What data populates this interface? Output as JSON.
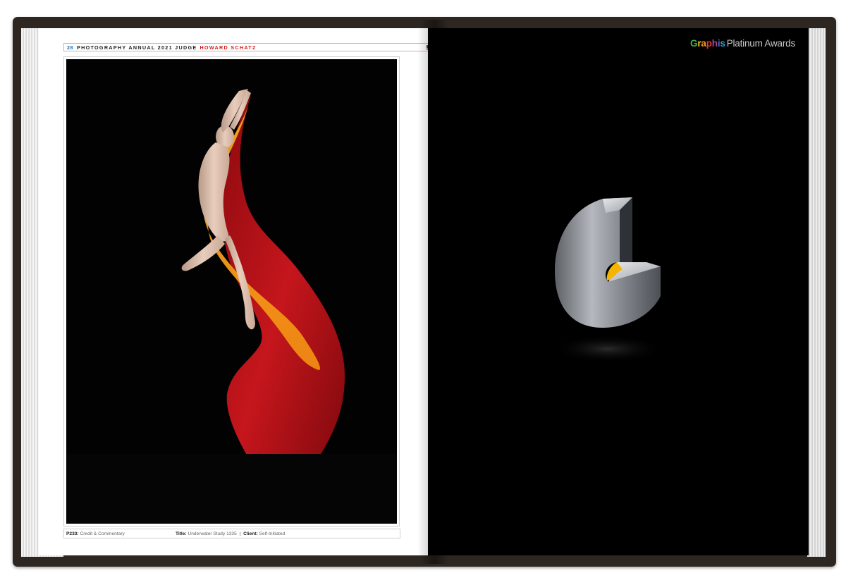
{
  "header": {
    "page_number": "28",
    "title": "PHOTOGRAPHY ANNUAL 2021 JUDGE",
    "judge_name": "HOWARD SCHATZ",
    "flag_icon": "us-flag-icon"
  },
  "footer": {
    "credit_label": "P233:",
    "credit_value": "Credit & Commentary",
    "title_label": "Title:",
    "title_value": "Underwater Study 1335",
    "separator": "|",
    "client_label": "Client:",
    "client_value": "Self-Initiated"
  },
  "logo": {
    "letters": [
      {
        "char": "G",
        "color": "#3db24b"
      },
      {
        "char": "r",
        "color": "#f2c417"
      },
      {
        "char": "a",
        "color": "#f39a1e"
      },
      {
        "char": "p",
        "color": "#e5362f"
      },
      {
        "char": "h",
        "color": "#a6449a"
      },
      {
        "char": "i",
        "color": "#4c6fc0"
      },
      {
        "char": "s",
        "color": "#22a3d8"
      }
    ],
    "suffix": "Platinum Awards"
  },
  "colors": {
    "cover": "#2d2621",
    "accent_blue": "#1f6fb5",
    "accent_red": "#d02020",
    "fabric_red": "#b8141a",
    "fabric_orange": "#f59a1f",
    "trophy_yellow": "#f5b400"
  }
}
